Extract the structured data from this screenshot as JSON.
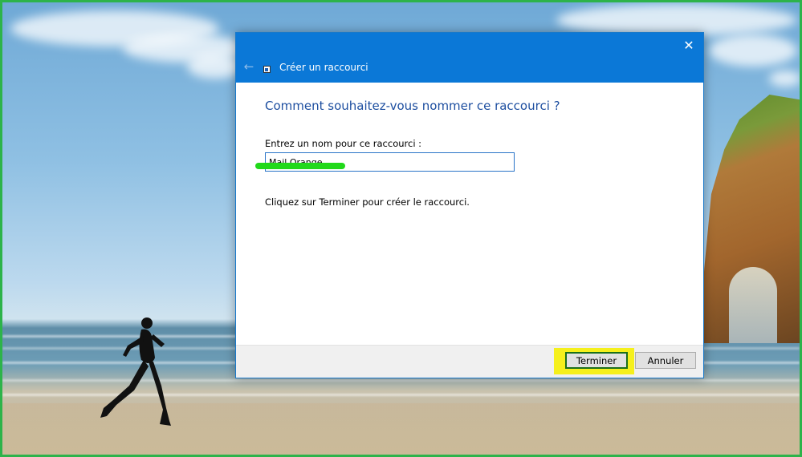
{
  "dialog": {
    "title": "Créer un raccourci",
    "heading": "Comment souhaitez-vous nommer ce raccourci ?",
    "name_label": "Entrez un nom pour ce raccourci :",
    "name_value": "Mail Orange",
    "hint": "Cliquez sur Terminer pour créer le raccourci.",
    "finish_label": "Terminer",
    "cancel_label": "Annuler",
    "close_glyph": "✕",
    "back_glyph": "←"
  },
  "colors": {
    "titlebar": "#0b78d7",
    "heading": "#1e4fa0",
    "frame_border": "#2db34a",
    "marker_green": "#21d91a",
    "marker_yellow": "#f5f01c"
  }
}
